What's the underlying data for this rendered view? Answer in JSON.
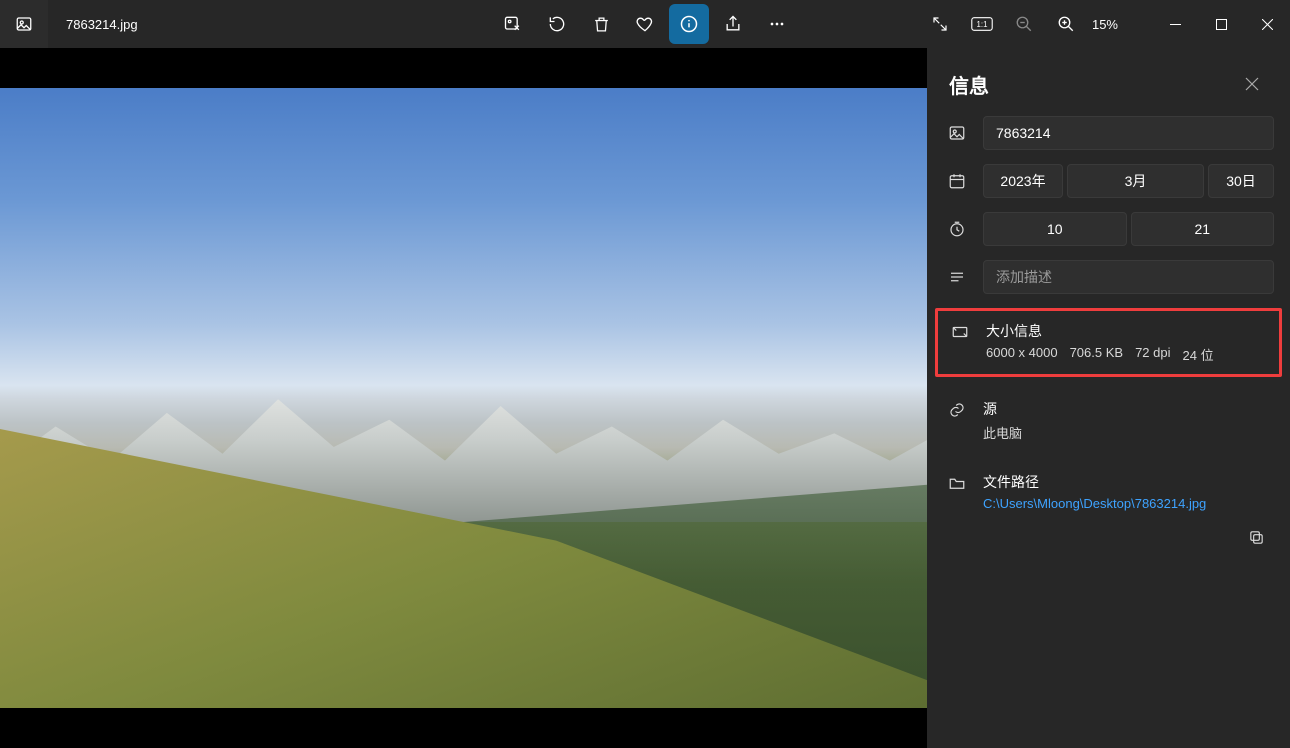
{
  "titlebar": {
    "filename": "7863214.jpg"
  },
  "zoom": {
    "level": "15%"
  },
  "panel": {
    "title": "信息",
    "name_value": "7863214",
    "date": {
      "year": "2023年",
      "month": "3月",
      "day": "30日"
    },
    "time": {
      "hour": "10",
      "minute": "21"
    },
    "description_placeholder": "添加描述",
    "size": {
      "title": "大小信息",
      "dimensions": "6000 x 4000",
      "filesize": "706.5 KB",
      "dpi": "72 dpi",
      "depth": "24 位"
    },
    "source": {
      "title": "源",
      "value": "此电脑"
    },
    "path": {
      "title": "文件路径",
      "value": "C:\\Users\\Mloong\\Desktop\\7863214.jpg"
    }
  }
}
